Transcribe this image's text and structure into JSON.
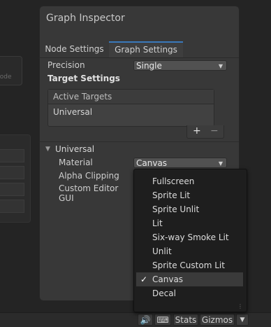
{
  "background": {
    "node_label": "Node"
  },
  "inspector": {
    "title": "Graph Inspector",
    "tabs": [
      {
        "label": "Node Settings"
      },
      {
        "label": "Graph Settings"
      }
    ],
    "precision_label": "Precision",
    "precision_value": "Single",
    "target_settings_label": "Target Settings",
    "active_targets_header": "Active Targets",
    "active_targets": [
      "Universal"
    ],
    "add_symbol": "+",
    "remove_symbol": "−",
    "section_title": "Universal",
    "fields": [
      {
        "label": "Material",
        "value": "Canvas"
      },
      {
        "label": "Alpha Clipping"
      },
      {
        "label": "Custom Editor GUI"
      }
    ]
  },
  "material_menu": {
    "items": [
      "Fullscreen",
      "Sprite Lit",
      "Sprite Unlit",
      "Lit",
      "Six-way Smoke Lit",
      "Unlit",
      "Sprite Custom Lit",
      "Canvas",
      "Decal"
    ],
    "selected": "Canvas",
    "checkmark": "✓"
  },
  "toolbar": {
    "audio_icon": "speaker-icon",
    "keyboard_icon": "keyboard-icon",
    "stats_label": "Stats",
    "gizmos_label": "Gizmos",
    "dropdown_icon": "chevron-down-icon"
  },
  "colors": {
    "accent": "#3a79bb",
    "panel": "#383838",
    "menu_bg": "#1e1e1e"
  }
}
